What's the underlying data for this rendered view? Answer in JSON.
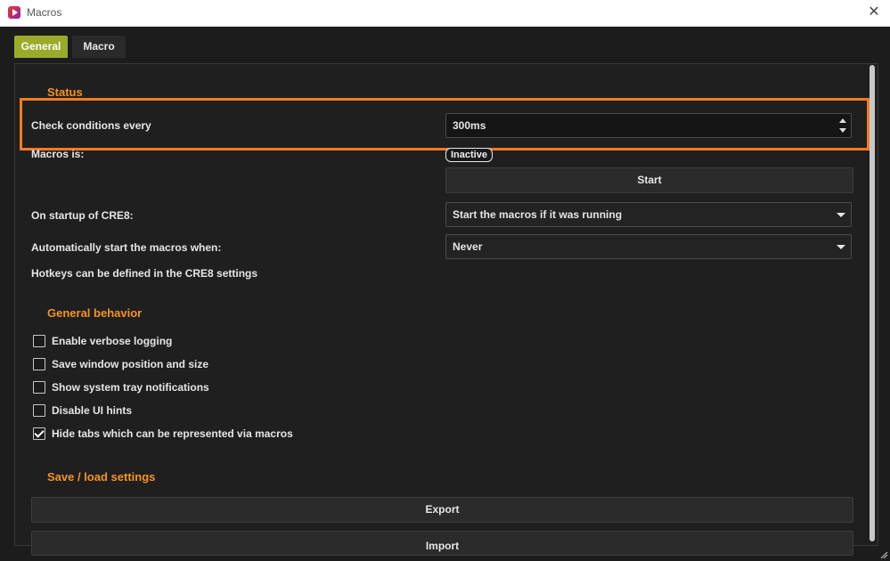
{
  "window": {
    "title": "Macros"
  },
  "tabs": [
    {
      "label": "General",
      "active": true
    },
    {
      "label": "Macro",
      "active": false
    }
  ],
  "status": {
    "title": "Status",
    "check_label": "Check conditions every",
    "check_value": "300ms",
    "macros_is_label": "Macros is:",
    "state_badge": "Inactive",
    "start_button": "Start",
    "startup_label": "On startup of CRE8:",
    "startup_value": "Start the macros if it was running",
    "autostart_label": "Automatically start the macros when:",
    "autostart_value": "Never",
    "hotkeys_note": "Hotkeys can be defined in the CRE8 settings"
  },
  "general_behavior": {
    "title": "General behavior",
    "options": [
      {
        "label": "Enable verbose logging",
        "checked": false
      },
      {
        "label": "Save window position and size",
        "checked": false
      },
      {
        "label": "Show system tray notifications",
        "checked": false
      },
      {
        "label": "Disable UI hints",
        "checked": false
      },
      {
        "label": "Hide tabs which can be represented via macros",
        "checked": true
      }
    ]
  },
  "save_load": {
    "title": "Save / load settings",
    "export_button": "Export",
    "import_button": "Import"
  },
  "colors": {
    "accent": "#f39322",
    "tab_active": "#9aab2a",
    "highlight": "#f47b20",
    "background": "#1f1f1f"
  }
}
